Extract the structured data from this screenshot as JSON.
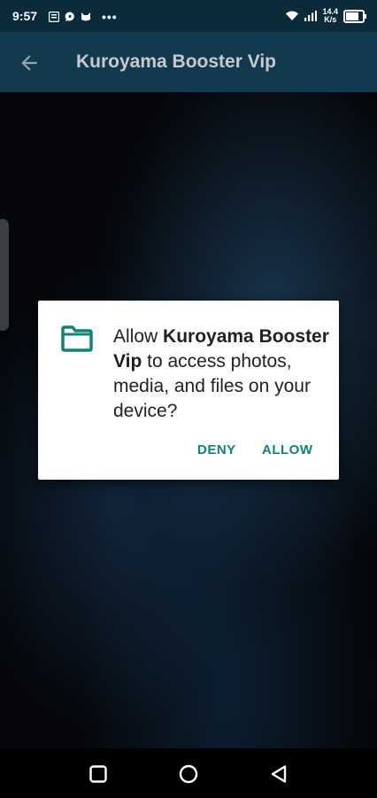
{
  "status_bar": {
    "time": "9:57",
    "network_speed_value": "14.4",
    "network_speed_unit": "K/s",
    "more_indicator": "•••",
    "battery_level": 0.85,
    "icons": [
      "news-icon",
      "chat-icon",
      "cat-icon",
      "wifi-icon",
      "signal-icon",
      "battery-icon"
    ]
  },
  "app_bar": {
    "title": "Kuroyama Booster Vip",
    "back_icon": "arrow-left-icon"
  },
  "dialog": {
    "message_prefix": "Allow ",
    "app_name": "Kuroyama Booster Vip",
    "message_suffix": " to access photos, media, and files on your device?",
    "icon": "folder-icon",
    "deny_label": "DENY",
    "allow_label": "ALLOW"
  },
  "navigation_bar": {
    "icons": [
      "square-recents-icon",
      "circle-home-icon",
      "triangle-back-icon"
    ]
  },
  "colors": {
    "app_bar": "#123a4e",
    "status_bar": "#0b2b3b",
    "accent": "#0c8477",
    "dialog_bg": "#ffffff"
  }
}
